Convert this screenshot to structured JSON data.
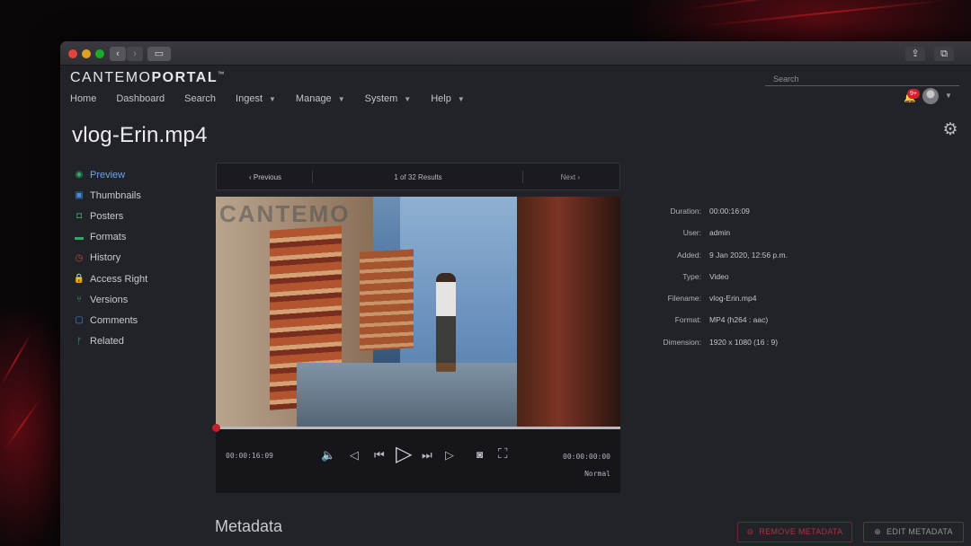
{
  "brand": {
    "prefix": "CANTEMO",
    "bold": "PORTAL",
    "mark": "™"
  },
  "nav": [
    {
      "label": "Home",
      "dropdown": false
    },
    {
      "label": "Dashboard",
      "dropdown": false
    },
    {
      "label": "Search",
      "dropdown": false
    },
    {
      "label": "Ingest",
      "dropdown": true
    },
    {
      "label": "Manage",
      "dropdown": true
    },
    {
      "label": "System",
      "dropdown": true
    },
    {
      "label": "Help",
      "dropdown": true
    }
  ],
  "search": {
    "placeholder": "Search",
    "value": ""
  },
  "notifications": {
    "badge": "9+"
  },
  "page": {
    "title": "vlog-Erin.mp4"
  },
  "sidebar": [
    {
      "label": "Preview",
      "icon": "eye-icon",
      "active": true
    },
    {
      "label": "Thumbnails",
      "icon": "image-icon"
    },
    {
      "label": "Posters",
      "icon": "camera-icon"
    },
    {
      "label": "Formats",
      "icon": "formats-icon"
    },
    {
      "label": "History",
      "icon": "clock-icon"
    },
    {
      "label": "Access Right",
      "icon": "lock-icon"
    },
    {
      "label": "Versions",
      "icon": "versions-icon"
    },
    {
      "label": "Comments",
      "icon": "comment-icon"
    },
    {
      "label": "Related",
      "icon": "branch-icon"
    }
  ],
  "pager": {
    "previous": "Previous",
    "count": "1 of 32 Results",
    "next": "Next"
  },
  "player": {
    "watermark": "CANTEMO",
    "current_time": "00:00:16:09",
    "end_time": "00:00:00:00",
    "speed": "Normal",
    "progress": 0.0
  },
  "metadata_fields": [
    {
      "label": "Duration:",
      "value": "00:00:16:09"
    },
    {
      "label": "User:",
      "value": "admin"
    },
    {
      "label": "Added:",
      "value": "9 Jan 2020, 12:56 p.m."
    },
    {
      "label": "Type:",
      "value": "Video"
    },
    {
      "label": "Filename:",
      "value": "vlog-Erin.mp4"
    },
    {
      "label": "Format:",
      "value": "MP4 (h264 : aac)"
    },
    {
      "label": "Dimension:",
      "value": "1920 x 1080 (16 : 9)"
    }
  ],
  "metadata_section": {
    "title": "Metadata",
    "remove_label": "REMOVE METADATA",
    "edit_label": "EDIT METADATA"
  },
  "colors": {
    "accent_active": "#6aa6e8",
    "danger": "#c0202a",
    "background": "#222229"
  }
}
